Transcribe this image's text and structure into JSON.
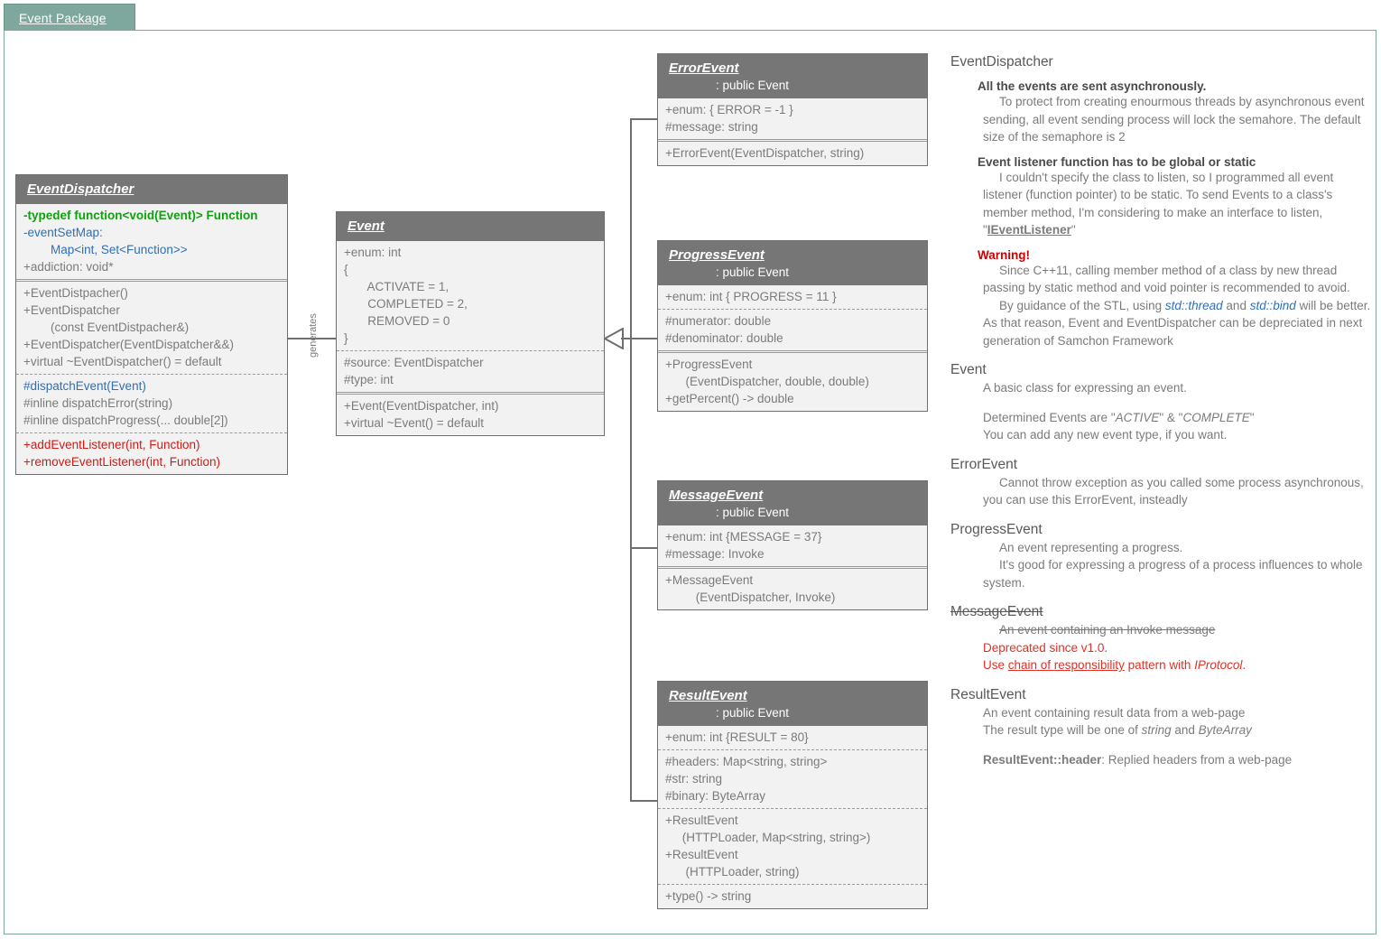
{
  "package": {
    "tab_label": "Event Package"
  },
  "colors": {
    "package_tab": "#7ea89d",
    "class_header": "#767676",
    "class_body": "#f2f2f2",
    "text_gray": "#7b7b7b",
    "accent_green": "#11a011",
    "accent_blue": "#2f6fb5",
    "accent_red": "#d11a16",
    "warning_red": "#cc0000"
  },
  "relationships": {
    "generates_label": "generates"
  },
  "classes": {
    "event_dispatcher": {
      "name": "EventDispatcher",
      "superclass": "",
      "attributes": [
        "-typedef function<void(Event)> Function",
        "-eventSetMap:",
        "        Map<int, Set<Function>>",
        "+addiction: void*"
      ],
      "constructors": [
        "+EventDistpacher()",
        "+EventDispatcher",
        "        (const EventDistpacher&)",
        "+EventDispatcher(EventDispatcher&&)",
        "+virtual ~EventDispatcher() = default"
      ],
      "dispatch_methods": [
        "#dispatchEvent(Event)",
        "#inline dispatchError(string)",
        "#inline dispatchProgress(... double[2])"
      ],
      "listener_methods": [
        "+addEventListener(int, Function)",
        "+removeEventListener(int, Function)"
      ]
    },
    "event": {
      "name": "Event",
      "superclass": "",
      "enum_block": [
        "+enum: int",
        "{",
        "       ACTIVATE = 1,",
        "       COMPLETED = 2,",
        "       REMOVED = 0",
        "}"
      ],
      "fields": [
        "#source: EventDispatcher",
        "#type: int"
      ],
      "methods": [
        "+Event(EventDispatcher, int)",
        "+virtual ~Event() = default"
      ]
    },
    "error_event": {
      "name": "ErrorEvent",
      "superclass": ": public Event",
      "fields": [
        "+enum: { ERROR = -1 }",
        "#message: string"
      ],
      "methods": [
        "+ErrorEvent(EventDispatcher, string)"
      ]
    },
    "progress_event": {
      "name": "ProgressEvent",
      "superclass": ": public Event",
      "enum_line": [
        "+enum: int { PROGRESS = 11 }"
      ],
      "fields": [
        "#numerator: double",
        "#denominator: double"
      ],
      "methods": [
        "+ProgressEvent",
        "      (EventDispatcher, double, double)",
        "+getPercent() -> double"
      ]
    },
    "message_event": {
      "name": "MessageEvent",
      "superclass": ": public Event",
      "fields": [
        "+enum: int {MESSAGE = 37}",
        "#message: Invoke"
      ],
      "methods": [
        "+MessageEvent",
        "         (EventDispatcher, Invoke)"
      ]
    },
    "result_event": {
      "name": "ResultEvent",
      "superclass": ": public Event",
      "enum_line": [
        "+enum: int {RESULT = 80}"
      ],
      "fields": [
        "#headers: Map<string, string>",
        "#str: string",
        "#binary: ByteArray"
      ],
      "constructors": [
        "+ResultEvent",
        "     (HTTPLoader, Map<string, string>)",
        "+ResultEvent",
        "      (HTTPLoader, string)"
      ],
      "methods": [
        "+type() -> string"
      ]
    }
  },
  "documentation": {
    "event_dispatcher": {
      "title": "EventDispatcher",
      "sub1_title": "All the events are sent asynchronously.",
      "sub1_body": "To protect from creating enourmous threads by asynchronous event sending, all event sending process will lock the semahore. The default size of the semaphore is 2",
      "sub2_title": "Event listener function has to be global or static",
      "sub2_body_a": "I couldn't specify the class to listen, so I programmed all event listener (function pointer) to be static. To send Events to a class's member method,  I'm considering to make an interface to listen, \"",
      "sub2_link": "IEventListener",
      "sub2_body_b": "\"",
      "warning_title": "Warning!",
      "warning_body_a": "Since C++11, calling member method of a class by new thread passing by static method and void pointer is recommended to avoid.",
      "warning_body_b_pre": "By guidance of the STL, using ",
      "warning_std_thread": "std::thread",
      "warning_body_b_mid": " and ",
      "warning_std_bind": "std::bind",
      "warning_body_b_post": " will be better. As that reason, Event and EventDispatcher can be depreciated in next generation of Samchon Framework"
    },
    "event": {
      "title": "Event",
      "body1": "A basic class for expressing an event.",
      "body2_pre": "Determined Events are \"",
      "body2_em1": "ACTIVE",
      "body2_mid": "\" & \"",
      "body2_em2": "COMPLETE",
      "body2_post": "\"",
      "body3": "You can add any new event type, if you want."
    },
    "error_event": {
      "title": "ErrorEvent",
      "body": "Cannot throw exception as you called some process asynchronous, you can use this ErrorEvent, insteadly"
    },
    "progress_event": {
      "title": "ProgressEvent",
      "body1": "An event representing a progress.",
      "body2": "It's good for expressing a progress of a process influences to whole system."
    },
    "message_event": {
      "title": "MessageEvent",
      "body_struck": "An event containing an Invoke message",
      "body_depr": "Deprecated since v1.0.",
      "body_use_pre": "Use ",
      "body_use_link": "chain of responsibility",
      "body_use_mid": " pattern with ",
      "body_use_em": "IProtocol",
      "body_use_post": "."
    },
    "result_event": {
      "title": "ResultEvent",
      "body1": "An event containing result data from a web-page",
      "body2_pre": "The result type will be one of ",
      "body2_em1": "string",
      "body2_mid": " and ",
      "body2_em2": "ByteArray",
      "body3_bold": "ResultEvent::header",
      "body3_rest": ": Replied headers from a web-page"
    }
  }
}
